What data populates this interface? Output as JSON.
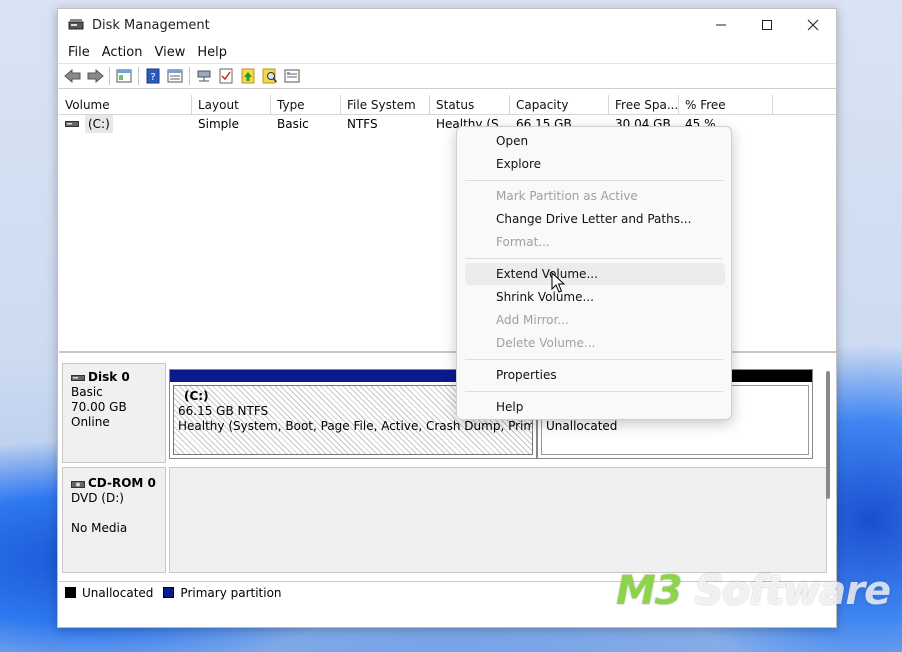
{
  "window": {
    "title": "Disk Management",
    "controls": {
      "minimize": "—",
      "maximize": "☐",
      "close": "✕"
    }
  },
  "menu": [
    "File",
    "Action",
    "View",
    "Help"
  ],
  "toolbar": {
    "icons": [
      "back-icon",
      "forward-icon",
      "console-tree-icon",
      "help-icon",
      "properties-icon",
      "connect-icon",
      "check-icon",
      "up-icon",
      "search-icon",
      "settings-icon"
    ]
  },
  "volume_table": {
    "columns": [
      "Volume",
      "Layout",
      "Type",
      "File System",
      "Status",
      "Capacity",
      "Free Spa...",
      "% Free"
    ],
    "rows": [
      {
        "volume": "(C:)",
        "layout": "Simple",
        "type": "Basic",
        "fs": "NTFS",
        "status": "Healthy (S...",
        "capacity": "66.15 GB",
        "free": "30.04 GB",
        "pct": "45 %"
      }
    ]
  },
  "disks": [
    {
      "name": "Disk 0",
      "type": "Basic",
      "size": "70.00 GB",
      "state": "Online"
    },
    {
      "name": "CD-ROM 0",
      "type": "DVD (D:)",
      "size": "",
      "state": "No Media"
    }
  ],
  "partitions": {
    "c_drive": {
      "label": "(C:)",
      "size": "66.15 GB NTFS",
      "status": "Healthy (System, Boot, Page File, Active, Crash Dump, Primary Pa"
    },
    "unallocated": {
      "label": "Unallocated"
    }
  },
  "legend": [
    {
      "label": "Unallocated",
      "color": "#000000"
    },
    {
      "label": "Primary partition",
      "color": "#0a1a8c"
    }
  ],
  "context_menu": {
    "open": "Open",
    "explore": "Explore",
    "mark_active": "Mark Partition as Active",
    "change_letter": "Change Drive Letter and Paths...",
    "format": "Format...",
    "extend": "Extend Volume...",
    "shrink": "Shrink Volume...",
    "add_mirror": "Add Mirror...",
    "delete": "Delete Volume...",
    "properties": "Properties",
    "help": "Help"
  },
  "watermark": {
    "brand_prefix": "M3",
    "brand_suffix": " Software"
  }
}
